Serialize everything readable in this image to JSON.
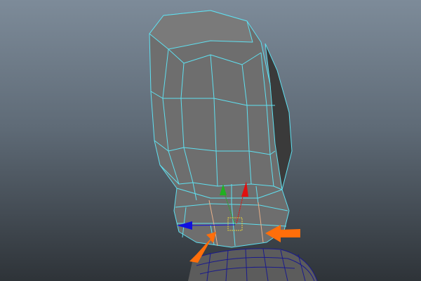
{
  "viewport": {
    "colors": {
      "wireframe_selected": "#5fe0f0",
      "wireframe_unselected": "#1a1a8c",
      "edge_loop_highlight": "#e8b08a",
      "mesh_fill": "#6e6e6e",
      "mesh_dark_side": "#3a3a3a",
      "annotation_arrow": "#ff6e0a",
      "manipulator_x": "#e01010",
      "manipulator_y": "#20b020",
      "manipulator_z": "#1010e0",
      "manipulator_center": "#e0d040"
    }
  }
}
